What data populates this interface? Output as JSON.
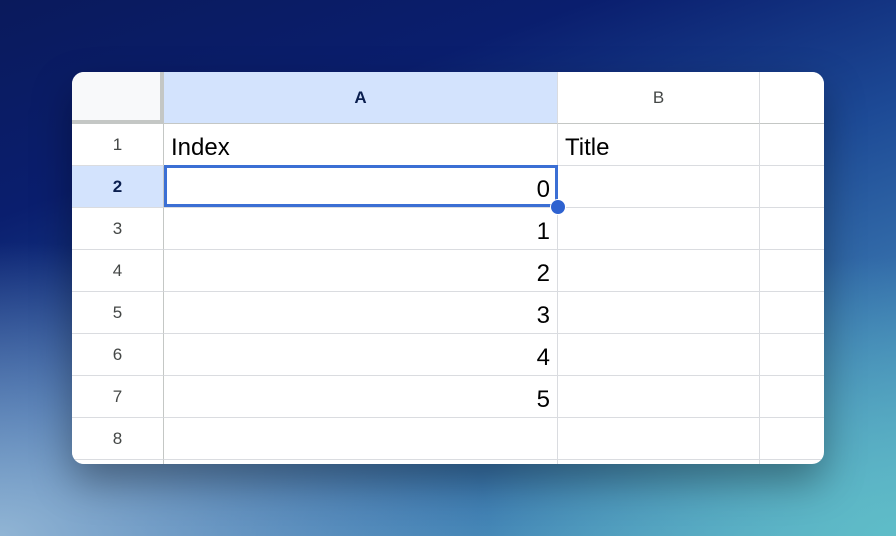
{
  "sheet": {
    "columns": [
      "A",
      "B"
    ],
    "selected_column": "A",
    "rows": [
      {
        "num": "1",
        "a": "Index",
        "b": "Title"
      },
      {
        "num": "2",
        "a": "0",
        "b": ""
      },
      {
        "num": "3",
        "a": "1",
        "b": ""
      },
      {
        "num": "4",
        "a": "2",
        "b": ""
      },
      {
        "num": "5",
        "a": "3",
        "b": ""
      },
      {
        "num": "6",
        "a": "4",
        "b": ""
      },
      {
        "num": "7",
        "a": "5",
        "b": ""
      },
      {
        "num": "8",
        "a": "",
        "b": ""
      }
    ],
    "selected_row": "2",
    "active_cell": "A2",
    "colors": {
      "selection_border": "#3b6fd4",
      "header_highlight": "#d3e3fd",
      "gridline": "#dadce0"
    }
  }
}
